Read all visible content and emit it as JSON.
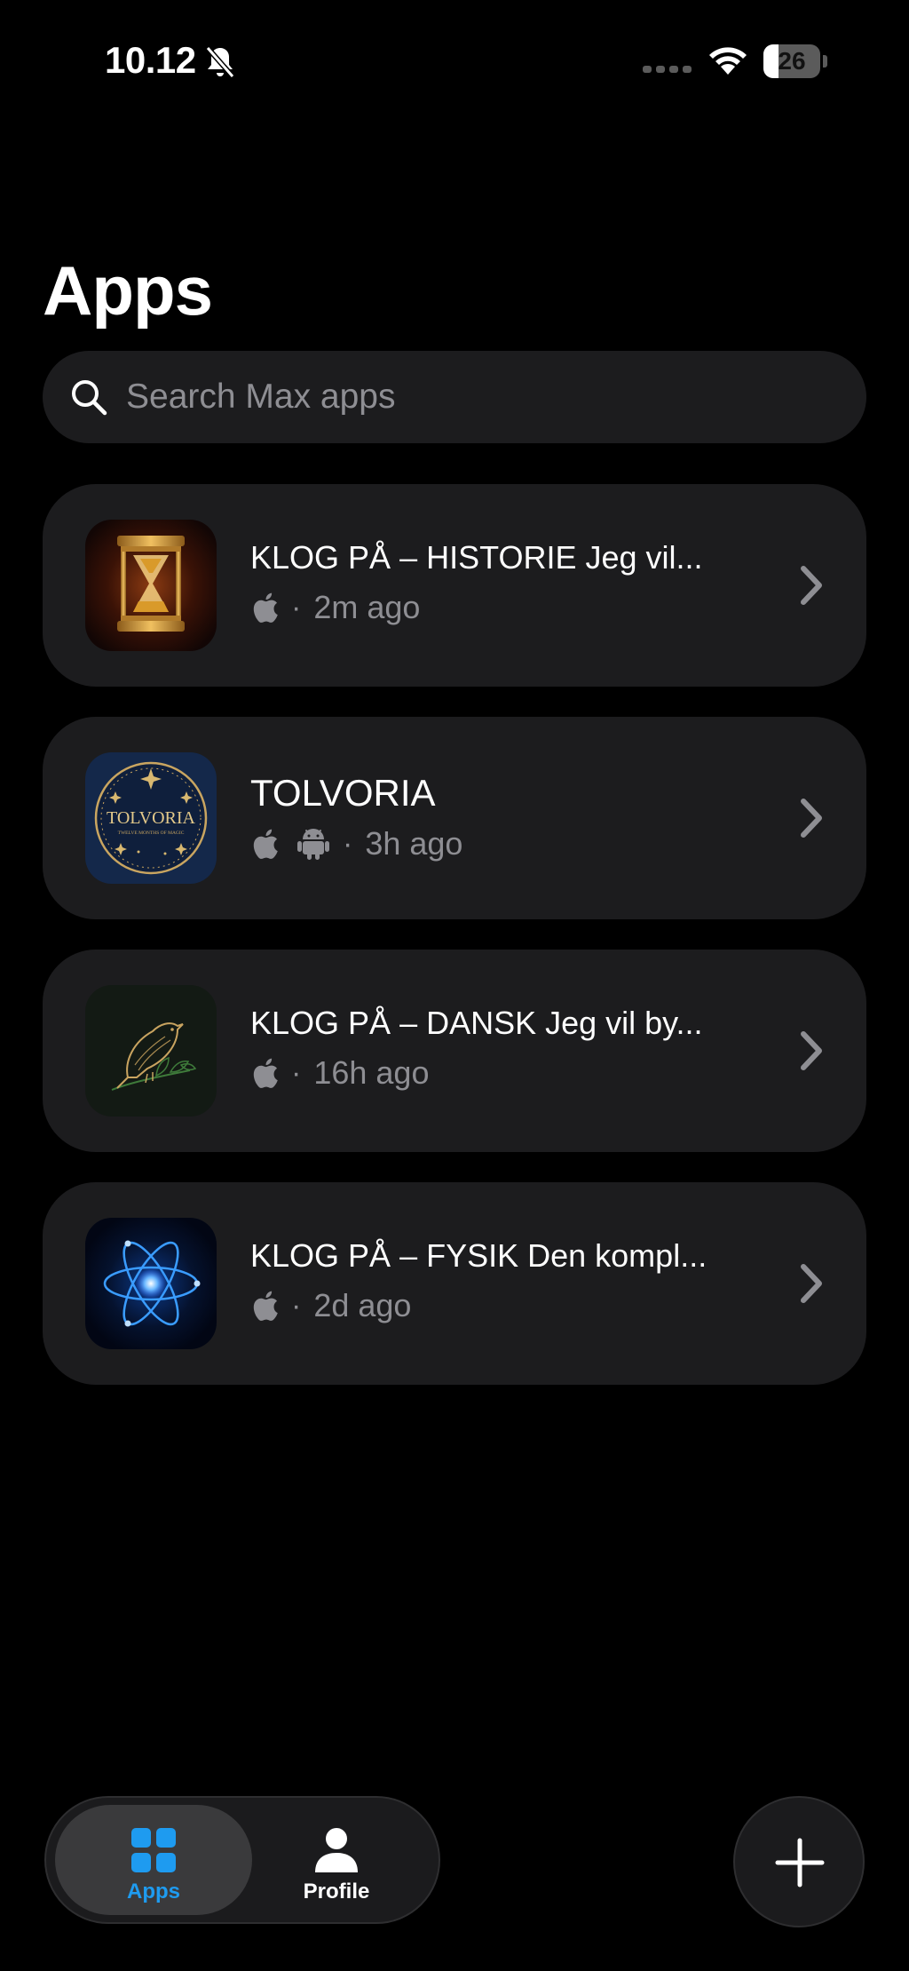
{
  "status_bar": {
    "time": "10.12",
    "battery_level": "26",
    "battery_fraction": 0.26,
    "icons": [
      "bell-slash-icon",
      "cellular-signal-icon",
      "wifi-icon",
      "battery-icon"
    ]
  },
  "header": {
    "title": "Apps"
  },
  "search": {
    "placeholder": "Search Max apps",
    "icon": "search-icon"
  },
  "apps": [
    {
      "title": "KLOG PÅ – HISTORIE Jeg vil...",
      "platforms": [
        "apple"
      ],
      "time": "2m ago",
      "icon": "hourglass-icon"
    },
    {
      "title": "TOLVORIA",
      "icon_text": "TOLVORIA",
      "icon_subtext": "TWELVE MONTHS OF MAGIC",
      "platforms": [
        "apple",
        "android"
      ],
      "time": "3h ago",
      "icon": "tolvoria-medallion-icon"
    },
    {
      "title": "KLOG PÅ – DANSK Jeg vil by...",
      "platforms": [
        "apple"
      ],
      "time": "16h ago",
      "icon": "bird-icon"
    },
    {
      "title": "KLOG PÅ – FYSIK Den kompl...",
      "platforms": [
        "apple"
      ],
      "time": "2d ago",
      "icon": "atom-icon"
    }
  ],
  "meta_separator": "·",
  "tab_bar": {
    "tabs": [
      {
        "label": "Apps",
        "icon": "grid-icon",
        "active": true
      },
      {
        "label": "Profile",
        "icon": "person-icon",
        "active": false
      }
    ]
  },
  "fab": {
    "icon": "plus-icon"
  },
  "colors": {
    "background": "#000000",
    "card": "#1c1c1e",
    "secondary_text": "#8e8e93",
    "accent": "#1e9bf0"
  }
}
